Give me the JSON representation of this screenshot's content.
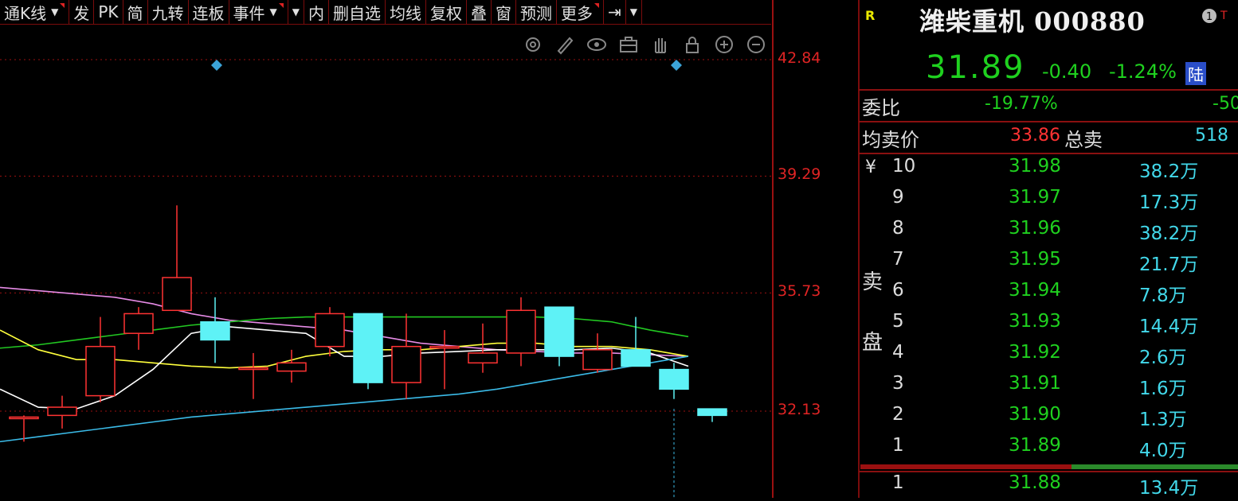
{
  "toolbar": {
    "items": [
      "通K线",
      "发",
      "PK",
      "简",
      "九转",
      "连板",
      "事件",
      "内",
      "删自选",
      "均线",
      "复权",
      "叠",
      "窗",
      "预测",
      "更多"
    ]
  },
  "chart": {
    "price_axis": [
      "42.84",
      "39.29",
      "35.73",
      "32.13"
    ],
    "colors": {
      "up": "#ff3333",
      "down": "#5ef2f6",
      "ma_pink": "#e68be6",
      "ma_white": "#ffffff",
      "ma_yellow": "#ffff3c",
      "ma_green": "#22c822",
      "ma_cyan": "#3bbbe8",
      "grid": "#9a1010"
    },
    "candles": [
      {
        "o": 31.95,
        "c": 31.95,
        "h": 32.0,
        "l": 31.2
      },
      {
        "o": 32.0,
        "c": 32.25,
        "h": 32.6,
        "l": 31.6
      },
      {
        "o": 32.6,
        "c": 34.1,
        "h": 35.0,
        "l": 32.4
      },
      {
        "o": 34.5,
        "c": 35.1,
        "h": 35.3,
        "l": 34.0
      },
      {
        "o": 35.2,
        "c": 36.2,
        "h": 38.4,
        "l": 35.2
      },
      {
        "o": 34.85,
        "c": 34.3,
        "h": 35.6,
        "l": 33.6
      },
      {
        "o": 33.45,
        "c": 33.45,
        "h": 33.9,
        "l": 32.5
      },
      {
        "o": 33.35,
        "c": 33.6,
        "h": 34.0,
        "l": 33.0
      },
      {
        "o": 34.1,
        "c": 35.1,
        "h": 35.3,
        "l": 33.8
      },
      {
        "o": 35.1,
        "c": 33.0,
        "h": 35.1,
        "l": 32.8
      },
      {
        "o": 33.0,
        "c": 34.1,
        "h": 35.1,
        "l": 32.5
      },
      {
        "o": 34.1,
        "c": 34.1,
        "h": 34.6,
        "l": 32.8
      },
      {
        "o": 33.6,
        "c": 33.9,
        "h": 34.8,
        "l": 33.3
      },
      {
        "o": 33.9,
        "c": 35.2,
        "h": 35.6,
        "l": 33.5
      },
      {
        "o": 35.3,
        "c": 33.8,
        "h": 35.3,
        "l": 33.5
      },
      {
        "o": 33.4,
        "c": 34.0,
        "h": 34.5,
        "l": 33.3
      },
      {
        "o": 34.0,
        "c": 33.5,
        "h": 35.0,
        "l": 33.5
      },
      {
        "o": 33.4,
        "c": 32.8,
        "h": 33.6,
        "l": 32.5
      },
      {
        "o": 32.2,
        "c": 32.0,
        "h": 32.2,
        "l": 31.8
      }
    ],
    "markers": [
      "diamond",
      "diamond"
    ]
  },
  "quote": {
    "badge": "R",
    "name": "潍柴重机",
    "code": "000880",
    "info_icon": "info-icon",
    "price": "31.89",
    "change": "-0.40",
    "change_pct": "-1.24%",
    "market_tag": "陆",
    "weibi_label": "委比",
    "weibi_value": "-19.77%",
    "weibi_diff": "-50",
    "avg_sell_label": "均卖价",
    "avg_sell_value": "33.86",
    "total_sell_label": "总卖",
    "total_sell_value": "518",
    "currency_symbol": "¥",
    "sell_label_1": "卖",
    "sell_label_2": "盘",
    "sell_levels": [
      {
        "level": "10",
        "price": "31.98",
        "volume": "38.2万"
      },
      {
        "level": "9",
        "price": "31.97",
        "volume": "17.3万"
      },
      {
        "level": "8",
        "price": "31.96",
        "volume": "38.2万"
      },
      {
        "level": "7",
        "price": "31.95",
        "volume": "21.7万"
      },
      {
        "level": "6",
        "price": "31.94",
        "volume": "7.8万"
      },
      {
        "level": "5",
        "price": "31.93",
        "volume": "14.4万"
      },
      {
        "level": "4",
        "price": "31.92",
        "volume": "2.6万"
      },
      {
        "level": "3",
        "price": "31.91",
        "volume": "1.6万"
      },
      {
        "level": "2",
        "price": "31.90",
        "volume": "1.3万"
      },
      {
        "level": "1",
        "price": "31.89",
        "volume": "4.0万"
      }
    ],
    "buy_levels": [
      {
        "level": "1",
        "price": "31.88",
        "volume": "13.4万"
      }
    ],
    "buy_sell_ratio": 0.44
  }
}
